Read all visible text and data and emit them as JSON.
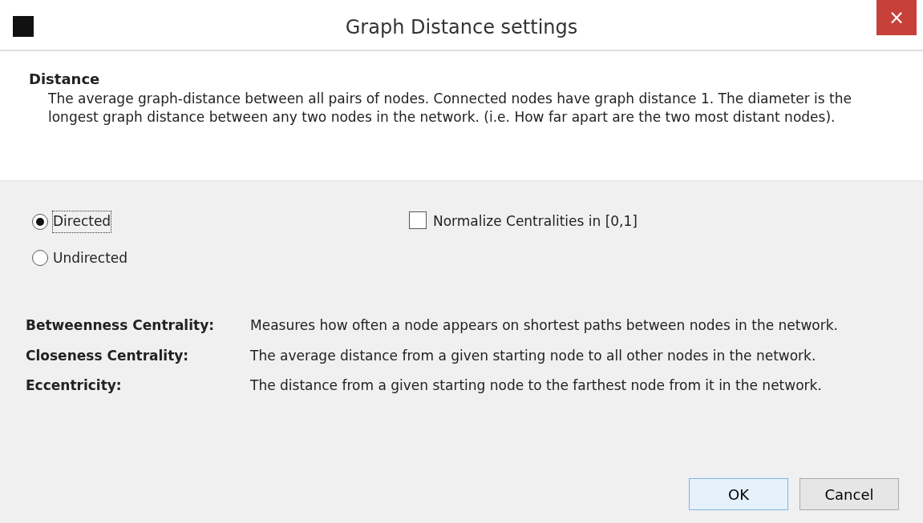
{
  "window": {
    "title": "Graph Distance settings",
    "close": "×"
  },
  "header": {
    "title": "Distance",
    "description": "The average graph-distance between all pairs of nodes. Connected nodes have graph distance 1. The diameter is the longest graph distance between any two nodes in the network. (i.e.  How far apart are the two most distant nodes)."
  },
  "radios": [
    {
      "label": "Directed",
      "selected": true
    },
    {
      "label": "Undirected",
      "selected": false
    }
  ],
  "checkbox": {
    "label": "Normalize Centralities in [0,1]",
    "checked": false
  },
  "definitions": [
    {
      "term": "Betweenness Centrality:",
      "text": "Measures how often a node appears on shortest paths between nodes in the network."
    },
    {
      "term": "Closeness Centrality:",
      "text": "The average distance from a given starting node to all other nodes in the network."
    },
    {
      "term": "Eccentricity:",
      "text": "The distance from a given starting node to the farthest node from it in the network."
    }
  ],
  "buttons": [
    {
      "label": "OK",
      "kind": "default"
    },
    {
      "label": "Cancel",
      "kind": "normal"
    }
  ]
}
